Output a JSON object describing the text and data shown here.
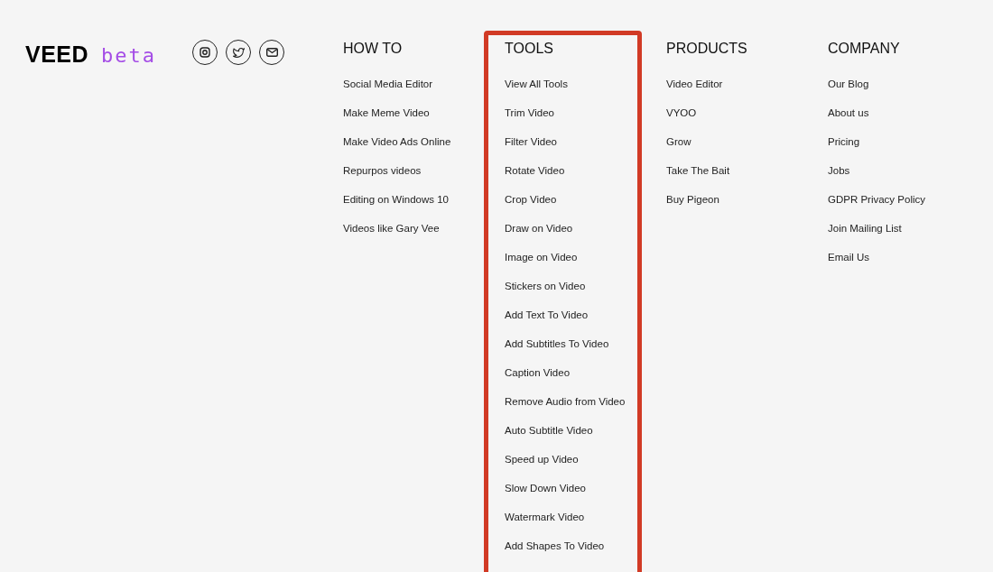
{
  "brand": {
    "logo": "VEED",
    "tag": "beta"
  },
  "social": [
    {
      "kind": "instagram"
    },
    {
      "kind": "twitter"
    },
    {
      "kind": "mail"
    }
  ],
  "columns": [
    {
      "heading": "HOW TO",
      "highlighted": false,
      "links": [
        "Social Media Editor",
        "Make Meme Video",
        "Make Video Ads Online",
        "Repurpos videos",
        "Editing on Windows 10",
        "Videos like Gary Vee"
      ]
    },
    {
      "heading": "TOOLS",
      "highlighted": true,
      "links": [
        "View All Tools",
        "Trim Video",
        "Filter Video",
        "Rotate Video",
        "Crop Video",
        "Draw on Video",
        "Image on Video",
        "Stickers on Video",
        "Add Text To Video",
        "Add Subtitles To Video",
        "Caption Video",
        "Remove Audio from Video",
        "Auto Subtitle Video",
        "Speed up Video",
        "Slow Down Video",
        "Watermark Video",
        "Add Shapes To Video"
      ]
    },
    {
      "heading": "PRODUCTS",
      "highlighted": false,
      "links": [
        "Video Editor",
        "VYOO",
        "Grow",
        "Take The Bait",
        "Buy Pigeon"
      ]
    },
    {
      "heading": "COMPANY",
      "highlighted": false,
      "links": [
        "Our Blog",
        "About us",
        "Pricing",
        "Jobs",
        "GDPR Privacy Policy",
        "Join Mailing List",
        "Email Us"
      ]
    }
  ]
}
